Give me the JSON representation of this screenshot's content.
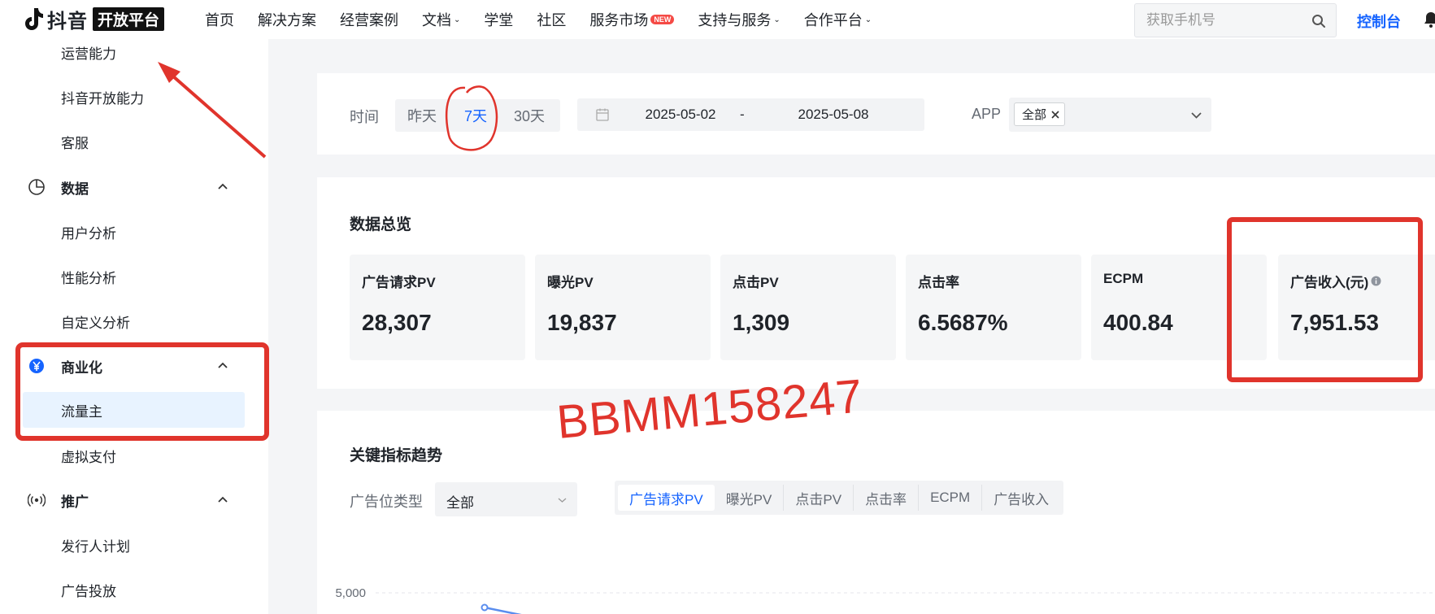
{
  "header": {
    "logo_text": "抖音",
    "logo_badge": "开放平台",
    "nav": [
      {
        "label": "首页",
        "caret": false
      },
      {
        "label": "解决方案",
        "caret": false
      },
      {
        "label": "经营案例",
        "caret": false
      },
      {
        "label": "文档",
        "caret": true
      },
      {
        "label": "学堂",
        "caret": false
      },
      {
        "label": "社区",
        "caret": false
      },
      {
        "label": "服务市场",
        "caret": false,
        "badge": "NEW"
      },
      {
        "label": "支持与服务",
        "caret": true
      },
      {
        "label": "合作平台",
        "caret": true
      }
    ],
    "search_placeholder": "获取手机号",
    "console_label": "控制台"
  },
  "sidebar": {
    "items": [
      {
        "label": "运营能力"
      },
      {
        "label": "抖音开放能力"
      },
      {
        "label": "客服"
      },
      {
        "label": "数据",
        "group": true,
        "icon": "pie-chart-icon"
      },
      {
        "label": "用户分析"
      },
      {
        "label": "性能分析"
      },
      {
        "label": "自定义分析"
      },
      {
        "label": "商业化",
        "group": true,
        "icon": "yuan-icon"
      },
      {
        "label": "流量主",
        "active": true
      },
      {
        "label": "虚拟支付"
      },
      {
        "label": "推广",
        "group": true,
        "icon": "broadcast-icon"
      },
      {
        "label": "发行人计划"
      },
      {
        "label": "广告投放"
      }
    ]
  },
  "filters": {
    "time_label": "时间",
    "time_options": [
      "昨天",
      "7天",
      "30天"
    ],
    "time_selected": "7天",
    "date_start": "2025-05-02",
    "date_separator": "-",
    "date_end": "2025-05-08",
    "app_label": "APP",
    "app_tag": "全部"
  },
  "overview": {
    "title": "数据总览",
    "metrics": [
      {
        "label": "广告请求PV",
        "value": "28,307"
      },
      {
        "label": "曝光PV",
        "value": "19,837"
      },
      {
        "label": "点击PV",
        "value": "1,309"
      },
      {
        "label": "点击率",
        "value": "6.5687%"
      },
      {
        "label": "ECPM",
        "value": "400.84"
      },
      {
        "label": "广告收入(元)",
        "value": "7,951.53",
        "info": true
      }
    ]
  },
  "trend": {
    "title": "关键指标趋势",
    "position_label": "广告位类型",
    "position_value": "全部",
    "tabs": [
      "广告请求PV",
      "曝光PV",
      "点击PV",
      "点击率",
      "ECPM",
      "广告收入"
    ],
    "active_tab": "广告请求PV",
    "y_tick": "5,000"
  },
  "watermark": "BBMM158247",
  "colors": {
    "accent": "#1664ff",
    "annotation": "#e0342c",
    "active_bg": "#e8f3ff"
  }
}
